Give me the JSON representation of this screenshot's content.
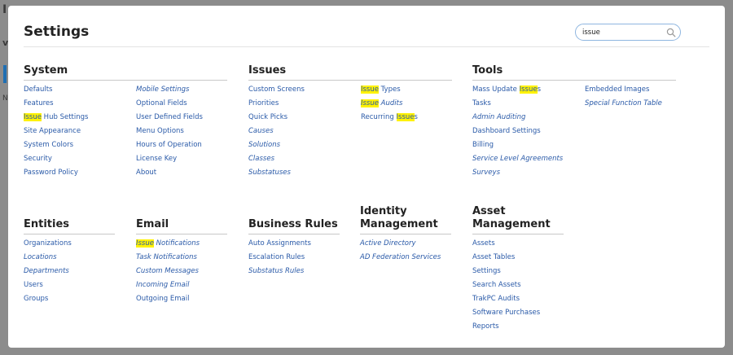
{
  "modal": {
    "title": "Settings",
    "search": {
      "value": "issue",
      "placeholder": ""
    }
  },
  "sections": [
    {
      "key": "system",
      "title": [
        "System"
      ],
      "columns": [
        [
          {
            "parts": [
              {
                "t": "Defaults"
              }
            ]
          },
          {
            "parts": [
              {
                "t": "Features"
              }
            ]
          },
          {
            "parts": [
              {
                "t": "Issue",
                "hl": true
              },
              {
                "t": " Hub Settings"
              }
            ]
          },
          {
            "parts": [
              {
                "t": "Site Appearance"
              }
            ]
          },
          {
            "parts": [
              {
                "t": "System Colors"
              }
            ]
          },
          {
            "parts": [
              {
                "t": "Security"
              }
            ]
          },
          {
            "parts": [
              {
                "t": "Password Policy"
              }
            ]
          }
        ],
        [
          {
            "parts": [
              {
                "t": "Mobile Settings"
              }
            ],
            "italic": true
          },
          {
            "parts": [
              {
                "t": "Optional Fields"
              }
            ]
          },
          {
            "parts": [
              {
                "t": "User Defined Fields"
              }
            ]
          },
          {
            "parts": [
              {
                "t": "Menu Options"
              }
            ]
          },
          {
            "parts": [
              {
                "t": "Hours of Operation"
              }
            ]
          },
          {
            "parts": [
              {
                "t": "License Key"
              }
            ]
          },
          {
            "parts": [
              {
                "t": "About"
              }
            ]
          }
        ]
      ]
    },
    {
      "key": "issues",
      "title": [
        "Issues"
      ],
      "columns": [
        [
          {
            "parts": [
              {
                "t": "Custom Screens"
              }
            ]
          },
          {
            "parts": [
              {
                "t": "Priorities"
              }
            ]
          },
          {
            "parts": [
              {
                "t": "Quick Picks"
              }
            ]
          },
          {
            "parts": [
              {
                "t": "Causes"
              }
            ],
            "italic": true
          },
          {
            "parts": [
              {
                "t": "Solutions"
              }
            ],
            "italic": true
          },
          {
            "parts": [
              {
                "t": "Classes"
              }
            ],
            "italic": true
          },
          {
            "parts": [
              {
                "t": "Substatuses"
              }
            ],
            "italic": true
          }
        ],
        [
          {
            "parts": [
              {
                "t": "Issue",
                "hl": true
              },
              {
                "t": " Types"
              }
            ]
          },
          {
            "parts": [
              {
                "t": "Issue",
                "hl": true
              },
              {
                "t": " Audits"
              }
            ],
            "italic": true
          },
          {
            "parts": [
              {
                "t": "Recurring "
              },
              {
                "t": "Issue",
                "hl": true
              },
              {
                "t": "s"
              }
            ]
          }
        ]
      ]
    },
    {
      "key": "tools",
      "title": [
        "Tools"
      ],
      "columns": [
        [
          {
            "parts": [
              {
                "t": "Mass Update "
              },
              {
                "t": "Issue",
                "hl": true
              },
              {
                "t": "s"
              }
            ]
          },
          {
            "parts": [
              {
                "t": "Tasks"
              }
            ]
          },
          {
            "parts": [
              {
                "t": "Admin Auditing"
              }
            ],
            "italic": true
          },
          {
            "parts": [
              {
                "t": "Dashboard Settings"
              }
            ]
          },
          {
            "parts": [
              {
                "t": "Billing"
              }
            ]
          },
          {
            "parts": [
              {
                "t": "Service Level Agreements"
              }
            ],
            "italic": true
          },
          {
            "parts": [
              {
                "t": "Surveys"
              }
            ],
            "italic": true
          }
        ],
        [
          {
            "parts": [
              {
                "t": "Embedded Images"
              }
            ]
          },
          {
            "parts": [
              {
                "t": "Special Function Table"
              }
            ],
            "italic": true
          }
        ]
      ]
    },
    {
      "key": "entities",
      "title": [
        "Entities"
      ],
      "columns": [
        [
          {
            "parts": [
              {
                "t": "Organizations"
              }
            ]
          },
          {
            "parts": [
              {
                "t": "Locations"
              }
            ],
            "italic": true
          },
          {
            "parts": [
              {
                "t": "Departments"
              }
            ],
            "italic": true
          },
          {
            "parts": [
              {
                "t": "Users"
              }
            ]
          },
          {
            "parts": [
              {
                "t": "Groups"
              }
            ]
          }
        ]
      ]
    },
    {
      "key": "email",
      "title": [
        "Email"
      ],
      "columns": [
        [
          {
            "parts": [
              {
                "t": "Issue",
                "hl": true
              },
              {
                "t": " Notifications"
              }
            ],
            "italic": true
          },
          {
            "parts": [
              {
                "t": "Task Notifications"
              }
            ],
            "italic": true
          },
          {
            "parts": [
              {
                "t": "Custom Messages"
              }
            ],
            "italic": true
          },
          {
            "parts": [
              {
                "t": "Incoming Email"
              }
            ],
            "italic": true
          },
          {
            "parts": [
              {
                "t": "Outgoing Email"
              }
            ]
          }
        ]
      ]
    },
    {
      "key": "business-rules",
      "title": [
        "Business Rules"
      ],
      "columns": [
        [
          {
            "parts": [
              {
                "t": "Auto Assignments"
              }
            ]
          },
          {
            "parts": [
              {
                "t": "Escalation Rules"
              }
            ]
          },
          {
            "parts": [
              {
                "t": "Substatus Rules"
              }
            ],
            "italic": true
          }
        ]
      ]
    },
    {
      "key": "identity-management",
      "title": [
        "Identity",
        "Management"
      ],
      "columns": [
        [
          {
            "parts": [
              {
                "t": "Active Directory"
              }
            ],
            "italic": true
          },
          {
            "parts": [
              {
                "t": "AD Federation Services"
              }
            ],
            "italic": true
          }
        ]
      ]
    },
    {
      "key": "asset-management",
      "title": [
        "Asset",
        "Management"
      ],
      "columns": [
        [
          {
            "parts": [
              {
                "t": "Assets"
              }
            ]
          },
          {
            "parts": [
              {
                "t": "Asset Tables"
              }
            ]
          },
          {
            "parts": [
              {
                "t": "Settings"
              }
            ]
          },
          {
            "parts": [
              {
                "t": "Search Assets"
              }
            ]
          },
          {
            "parts": [
              {
                "t": "TrakPC Audits"
              }
            ]
          },
          {
            "parts": [
              {
                "t": "Software Purchases"
              }
            ]
          },
          {
            "parts": [
              {
                "t": "Reports"
              }
            ]
          }
        ]
      ]
    }
  ]
}
